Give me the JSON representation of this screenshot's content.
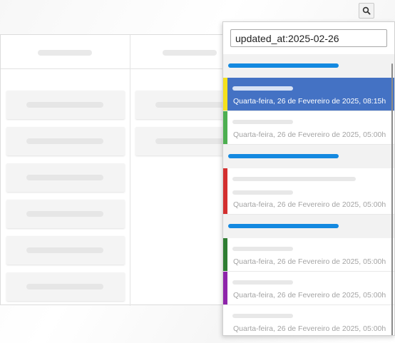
{
  "search": {
    "query": "updated_at:2025-02-26",
    "button_icon": "search-icon"
  },
  "results": {
    "groups": [
      {
        "accent": "#1489e0",
        "items": [
          {
            "date": "Quarta-feira, 26 de Fevereiro de 2025, 08:15h",
            "stripe": "#f5e11c",
            "selected": true
          },
          {
            "date": "Quarta-feira, 26 de Fevereiro de 2025, 05:00h",
            "stripe": "#4caf50",
            "selected": false
          }
        ]
      },
      {
        "accent": "#1489e0",
        "items": [
          {
            "date": "Quarta-feira, 26 de Fevereiro de 2025, 05:00h",
            "stripe": "#d32f2f",
            "selected": false
          }
        ]
      },
      {
        "accent": "#1489e0",
        "items": [
          {
            "date": "Quarta-feira, 26 de Fevereiro de 2025, 05:00h",
            "stripe": "#2e7d32",
            "selected": false
          },
          {
            "date": "Quarta-feira, 26 de Fevereiro de 2025, 05:00h",
            "stripe": "#8e24aa",
            "selected": false
          },
          {
            "date": "Quarta-feira, 26 de Fevereiro de 2025, 05:00h",
            "stripe": "",
            "selected": false
          }
        ]
      }
    ]
  },
  "colors": {
    "selected_background": "#4472c4",
    "group_accent": "#1489e0"
  }
}
